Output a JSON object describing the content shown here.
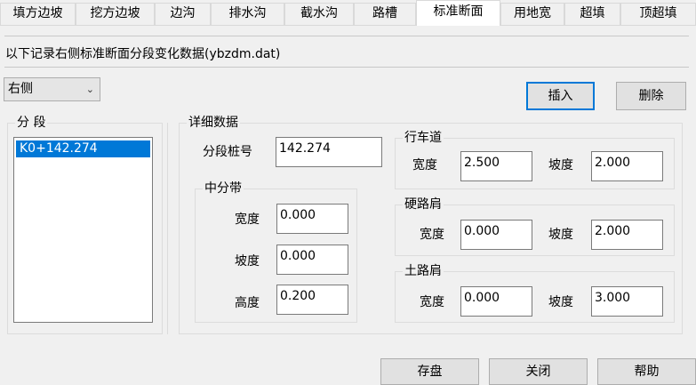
{
  "tabs": [
    {
      "label": "填方边坡"
    },
    {
      "label": "挖方边坡"
    },
    {
      "label": "边沟"
    },
    {
      "label": "排水沟"
    },
    {
      "label": "截水沟"
    },
    {
      "label": "路槽"
    },
    {
      "label": "标准断面"
    },
    {
      "label": "用地宽"
    },
    {
      "label": "超填"
    },
    {
      "label": "顶超填"
    }
  ],
  "active_tab": "标准断面",
  "description": "以下记录右侧标准断面分段变化数据(ybzdm.dat)",
  "side_select": {
    "value": "右侧"
  },
  "buttons": {
    "insert": "插入",
    "delete": "删除"
  },
  "segments": {
    "title": "分 段",
    "items": [
      "K0+142.274"
    ]
  },
  "details": {
    "title": "详细数据",
    "station_label": "分段桩号",
    "station_value": "142.274",
    "median": {
      "title": "中分带",
      "width_label": "宽度",
      "width_value": "0.000",
      "slope_label": "坡度",
      "slope_value": "0.000",
      "height_label": "高度",
      "height_value": "0.200"
    },
    "carriageway": {
      "title": "行车道",
      "width_label": "宽度",
      "width_value": "2.500",
      "slope_label": "坡度",
      "slope_value": "2.000"
    },
    "hard_shoulder": {
      "title": "硬路肩",
      "width_label": "宽度",
      "width_value": "0.000",
      "slope_label": "坡度",
      "slope_value": "2.000"
    },
    "earth_shoulder": {
      "title": "土路肩",
      "width_label": "宽度",
      "width_value": "0.000",
      "slope_label": "坡度",
      "slope_value": "3.000"
    }
  },
  "footer": {
    "save": "存盘",
    "close": "关闭",
    "help": "帮助"
  }
}
